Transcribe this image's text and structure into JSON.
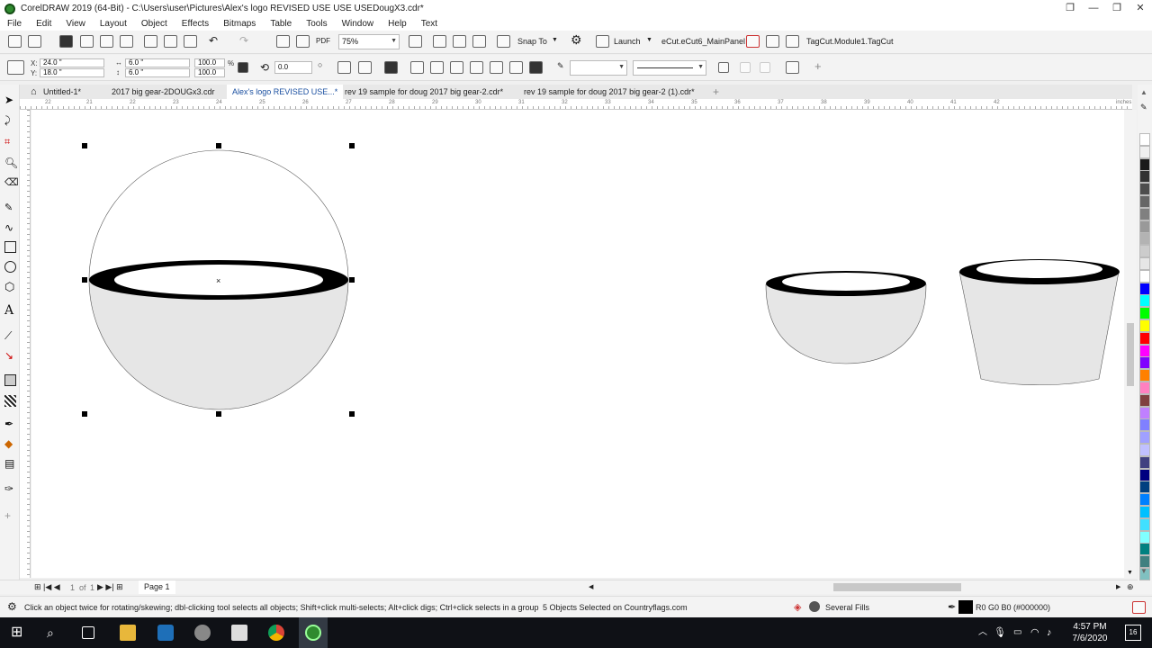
{
  "window": {
    "title": "CorelDRAW 2019 (64-Bit) - C:\\Users\\user\\Pictures\\Alex's logo REVISED USE USE USEDougX3.cdr*",
    "controls": [
      "❐",
      "—",
      "❐",
      "✕"
    ]
  },
  "menu": [
    "File",
    "Edit",
    "View",
    "Layout",
    "Object",
    "Effects",
    "Bitmaps",
    "Table",
    "Tools",
    "Window",
    "Help",
    "Text"
  ],
  "toolbar": {
    "zoom": "75%",
    "snap_to": "Snap To",
    "launch": "Launch",
    "ecut_panel": "eCut.eCut6_MainPanel",
    "tagcut": "TagCut.Module1.TagCut",
    "pdf_label": "PDF"
  },
  "propbar": {
    "x_label": "X:",
    "x_value": "24.0 \"",
    "y_label": "Y:",
    "y_value": "18.0 \"",
    "w_value": "6.0 \"",
    "h_value": "6.0 \"",
    "scale_w": "100.0",
    "scale_h": "100.0",
    "percent": "%",
    "rotation": "0.0"
  },
  "tabs": [
    {
      "label": "Untitled-1*",
      "active": false
    },
    {
      "label": "2017 big gear-2DOUGx3.cdr",
      "active": false
    },
    {
      "label": "Alex's logo REVISED USE...*",
      "active": true
    },
    {
      "label": "rev 19 sample for doug 2017 big gear-2.cdr*",
      "active": false
    },
    {
      "label": "rev 19 sample for doug 2017 big gear-2 (1).cdr*",
      "active": false
    }
  ],
  "ruler": {
    "numbers": [
      "22",
      "21",
      "22",
      "23",
      "24",
      "25",
      "26",
      "27",
      "28",
      "29",
      "30",
      "31",
      "32",
      "33",
      "34",
      "35",
      "36",
      "37",
      "38",
      "39",
      "40",
      "41",
      "42"
    ],
    "unit": "inches"
  },
  "page_nav": {
    "of_label": "of",
    "current": "1",
    "total": "1",
    "page_tab": "Page 1"
  },
  "status": {
    "hint": "Click an object twice for rotating/skewing; dbl-clicking tool selects all objects; Shift+click multi-selects; Alt+click digs; Ctrl+click selects in a group",
    "selection": "5 Objects Selected on Countryflags.com",
    "fill": "Several Fills",
    "outline": "R0 G0 B0 (#000000)"
  },
  "palette": [
    "#ffffff",
    "#f0f0f0",
    "#1a1a1a",
    "#333333",
    "#4d4d4d",
    "#666666",
    "#808080",
    "#999999",
    "#b3b3b3",
    "#cccccc",
    "#e6e6e6",
    "#ffffff",
    "#0000ff",
    "#00ffff",
    "#00ff00",
    "#ffff00",
    "#ff0000",
    "#ff00ff",
    "#8000ff",
    "#ff8000",
    "#ff80c0",
    "#804040",
    "#c080ff",
    "#8080ff",
    "#a0a0ff",
    "#c0c0ff",
    "#404080",
    "#000080",
    "#004080",
    "#0080ff",
    "#00c0ff",
    "#40e0ff",
    "#80ffff",
    "#008080",
    "#408080",
    "#80c0c0"
  ],
  "taskbar": {
    "time": "4:57 PM",
    "date": "7/6/2020",
    "notification_count": "16"
  }
}
